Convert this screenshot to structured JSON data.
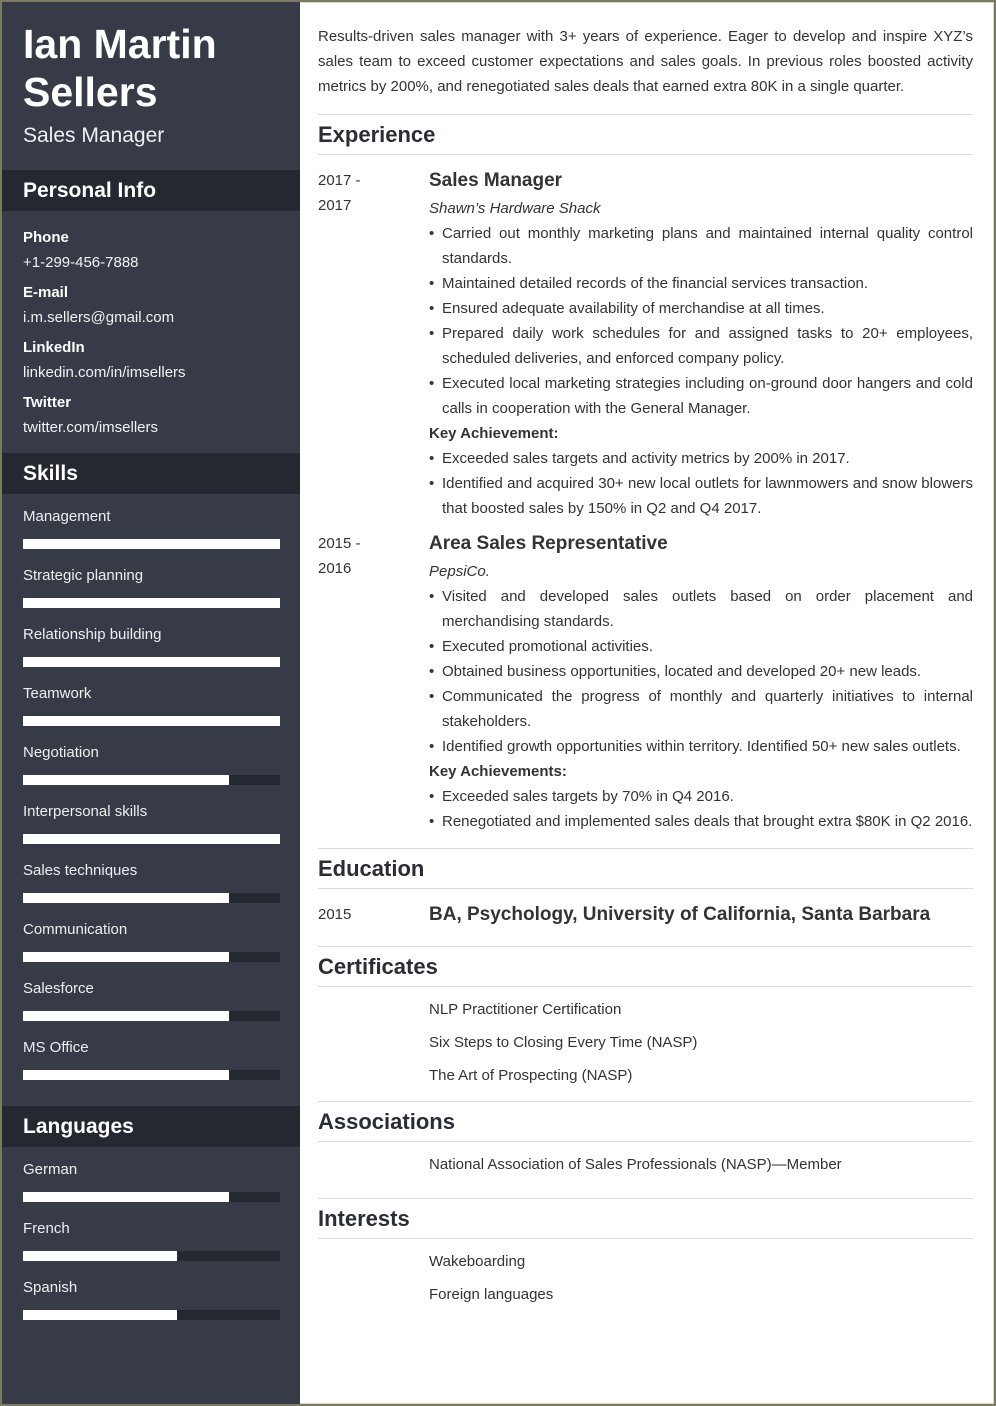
{
  "header": {
    "name_line1": "Ian Martin",
    "name_line2": "Sellers",
    "role": "Sales Manager"
  },
  "personal_info": {
    "title": "Personal Info",
    "items": [
      {
        "label": "Phone",
        "value": "+1-299-456-7888"
      },
      {
        "label": "E-mail",
        "value": "i.m.sellers@gmail.com"
      },
      {
        "label": "LinkedIn",
        "value": "linkedin.com/in/imsellers"
      },
      {
        "label": "Twitter",
        "value": "twitter.com/imsellers"
      }
    ]
  },
  "skills": {
    "title": "Skills",
    "items": [
      {
        "label": "Management",
        "level": 1.0
      },
      {
        "label": "Strategic planning",
        "level": 1.0
      },
      {
        "label": "Relationship building",
        "level": 1.0
      },
      {
        "label": "Teamwork",
        "level": 1.0
      },
      {
        "label": "Negotiation",
        "level": 0.8
      },
      {
        "label": "Interpersonal skills",
        "level": 1.0
      },
      {
        "label": "Sales techniques",
        "level": 0.8
      },
      {
        "label": "Communication",
        "level": 0.8
      },
      {
        "label": "Salesforce",
        "level": 0.8
      },
      {
        "label": "MS Office",
        "level": 0.8
      }
    ]
  },
  "languages": {
    "title": "Languages",
    "items": [
      {
        "label": " German",
        "level": 0.8
      },
      {
        "label": "French",
        "level": 0.6
      },
      {
        "label": "Spanish",
        "level": 0.6
      }
    ]
  },
  "summary": "Results-driven sales manager with 3+ years of experience. Eager to develop and inspire XYZ’s sales team to exceed customer expectations and sales goals. In previous roles boosted activity metrics by 200%, and renegotiated sales deals that earned extra 80K in a single quarter.",
  "experience": {
    "title": "Experience",
    "jobs": [
      {
        "date_from": "2017 -",
        "date_to": "2017",
        "title": "Sales Manager",
        "company": "Shawn’s Hardware Shack",
        "bullets": [
          "Carried out monthly marketing plans and maintained internal quality control standards.",
          "Maintained detailed records of the financial services transaction.",
          "Ensured adequate availability of merchandise at all times.",
          "Prepared daily work schedules for and assigned tasks to 20+ employees, scheduled deliveries, and enforced company policy.",
          "Executed local marketing strategies including on-ground door hangers and cold calls in cooperation with the General Manager."
        ],
        "achievements_label": "Key Achievement:",
        "achievements": [
          "Exceeded sales targets and activity metrics by 200% in 2017.",
          "Identified and acquired 30+ new local outlets for lawnmowers and snow blowers that boosted sales by 150% in Q2 and Q4 2017."
        ]
      },
      {
        "date_from": "2015 -",
        "date_to": "2016",
        "title": "Area Sales Representative",
        "company": "PepsiCo.",
        "bullets": [
          "Visited and developed sales outlets based on order placement and merchandising standards.",
          "Executed promotional activities.",
          "Obtained business opportunities, located and developed 20+ new leads.",
          "Communicated the progress of monthly and quarterly initiatives to internal stakeholders.",
          "Identified growth opportunities within territory. Identified 50+ new sales outlets."
        ],
        "achievements_label": "Key Achievements:",
        "achievements": [
          "Exceeded sales targets by 70% in Q4 2016.",
          "Renegotiated and implemented sales deals that brought extra $80K in Q2 2016."
        ]
      }
    ]
  },
  "education": {
    "title": "Education",
    "date": "2015",
    "degree": "BA, Psychology, University of California, Santa Barbara"
  },
  "certificates": {
    "title": "Certificates",
    "items": [
      "NLP Practitioner Certification",
      "Six Steps to Closing Every Time (NASP)",
      "The Art of Prospecting (NASP)"
    ]
  },
  "associations": {
    "title": "Associations",
    "items": [
      "National Association of Sales Professionals (NASP)—Member"
    ]
  },
  "interests": {
    "title": "Interests",
    "items": [
      "Wakeboarding",
      "Foreign languages"
    ]
  }
}
